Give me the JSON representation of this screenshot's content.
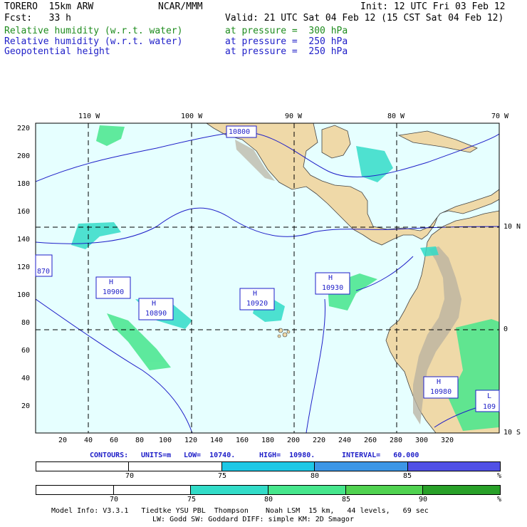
{
  "header": {
    "model": "TORERO  15km ARW",
    "center": "NCAR/MMM",
    "init": "Init: 12 UTC Fri 03 Feb 12",
    "fcst": "Fcst:   33 h",
    "valid": "Valid: 21 UTC Sat 04 Feb 12 (15 CST Sat 04 Feb 12)",
    "fields": [
      {
        "label": "Relative humidity (w.r.t. water)",
        "level": "at pressure =  300 hPa",
        "color": "#1e8c1e"
      },
      {
        "label": "Relative humidity (w.r.t. water)",
        "level": "at pressure =  250 hPa",
        "color": "#1e1ec8"
      },
      {
        "label": "Geopotential height",
        "level": "at pressure =  250 hPa",
        "color": "#1e1ec8"
      }
    ]
  },
  "axes": {
    "top_labels": [
      "110 W",
      "100 W",
      "90 W",
      "80 W",
      "70 W"
    ],
    "right_labels": [
      "10 N",
      "0",
      "10 S"
    ],
    "left_ticks": [
      "220",
      "200",
      "180",
      "160",
      "140",
      "120",
      "100",
      "80",
      "60",
      "40",
      "20"
    ],
    "bottom_ticks": [
      "20",
      "40",
      "60",
      "80",
      "100",
      "120",
      "140",
      "160",
      "180",
      "200",
      "220",
      "240",
      "260",
      "280",
      "300",
      "320"
    ]
  },
  "highs": [
    {
      "label": "H",
      "value": "10900"
    },
    {
      "label": "H",
      "value": "10890"
    },
    {
      "label": "H",
      "value": "10920"
    },
    {
      "label": "H",
      "value": "10930"
    },
    {
      "label": "H",
      "value": "10980"
    }
  ],
  "contour_labels": [
    "10800",
    "870",
    "109"
  ],
  "low_marker": "L",
  "contour_info": {
    "contours": "CONTOURS:",
    "units": "UNITS=m",
    "low": "LOW=  10740.",
    "high": "HIGH=  10980.",
    "interval": "INTERVAL=   60.000"
  },
  "colorbar_blue": {
    "ticks": [
      "70",
      "75",
      "80",
      "85"
    ],
    "unit": "%",
    "colors": [
      "#ffffff",
      "#ffffff",
      "#1ec8e6",
      "#3c96e6",
      "#5050e6"
    ]
  },
  "colorbar_green": {
    "ticks": [
      "70",
      "75",
      "80",
      "85",
      "90"
    ],
    "unit": "%",
    "colors": [
      "#ffffff",
      "#ffffff",
      "#32dcc8",
      "#46e68c",
      "#50d250",
      "#28a028"
    ]
  },
  "footer": {
    "line1": "Model Info: V3.3.1   Tiedtke YSU PBL  Thompson    Noah LSM  15 km,   44 levels,   69 sec",
    "line2": "LW: Godd SW: Goddard DIFF: simple KM: 2D Smagor"
  },
  "colors": {
    "ocean": "#e6ffff",
    "land": "#efd9a8",
    "contour": "#1e1ec8"
  }
}
